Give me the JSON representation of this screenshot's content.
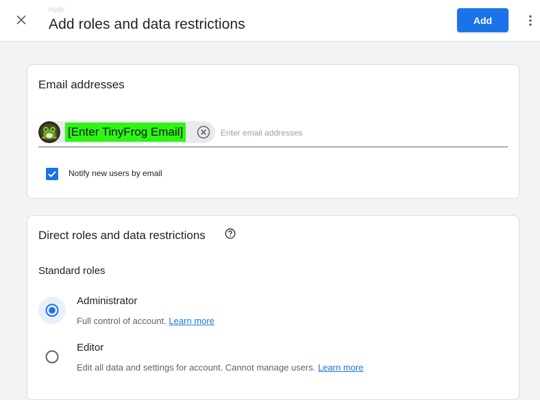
{
  "header": {
    "breadcrumb": "Hydy",
    "title": "Add roles and data restrictions",
    "add_label": "Add",
    "icons": {
      "close": "close-icon",
      "more": "more-vert-icon"
    }
  },
  "email_section": {
    "title": "Email addresses",
    "chips": [
      {
        "label": "[Enter TinyFrog Email]",
        "avatar": "frog-avatar"
      }
    ],
    "input_value": "",
    "input_placeholder": "Enter email addresses",
    "notify_label": "Notify new users by email",
    "notify_checked": true
  },
  "roles_section": {
    "title": "Direct roles and data restrictions",
    "standard_roles_label": "Standard roles",
    "roles": [
      {
        "name": "Administrator",
        "description": "Full control of account.",
        "link": "Learn more",
        "selected": true
      },
      {
        "name": "Editor",
        "description": "Edit all data and settings for account. Cannot manage users.",
        "link": "Learn more",
        "selected": false
      }
    ]
  },
  "colors": {
    "accent": "#1a73e8",
    "chip_highlight": "#2ef515",
    "background": "#f1f3f4"
  }
}
